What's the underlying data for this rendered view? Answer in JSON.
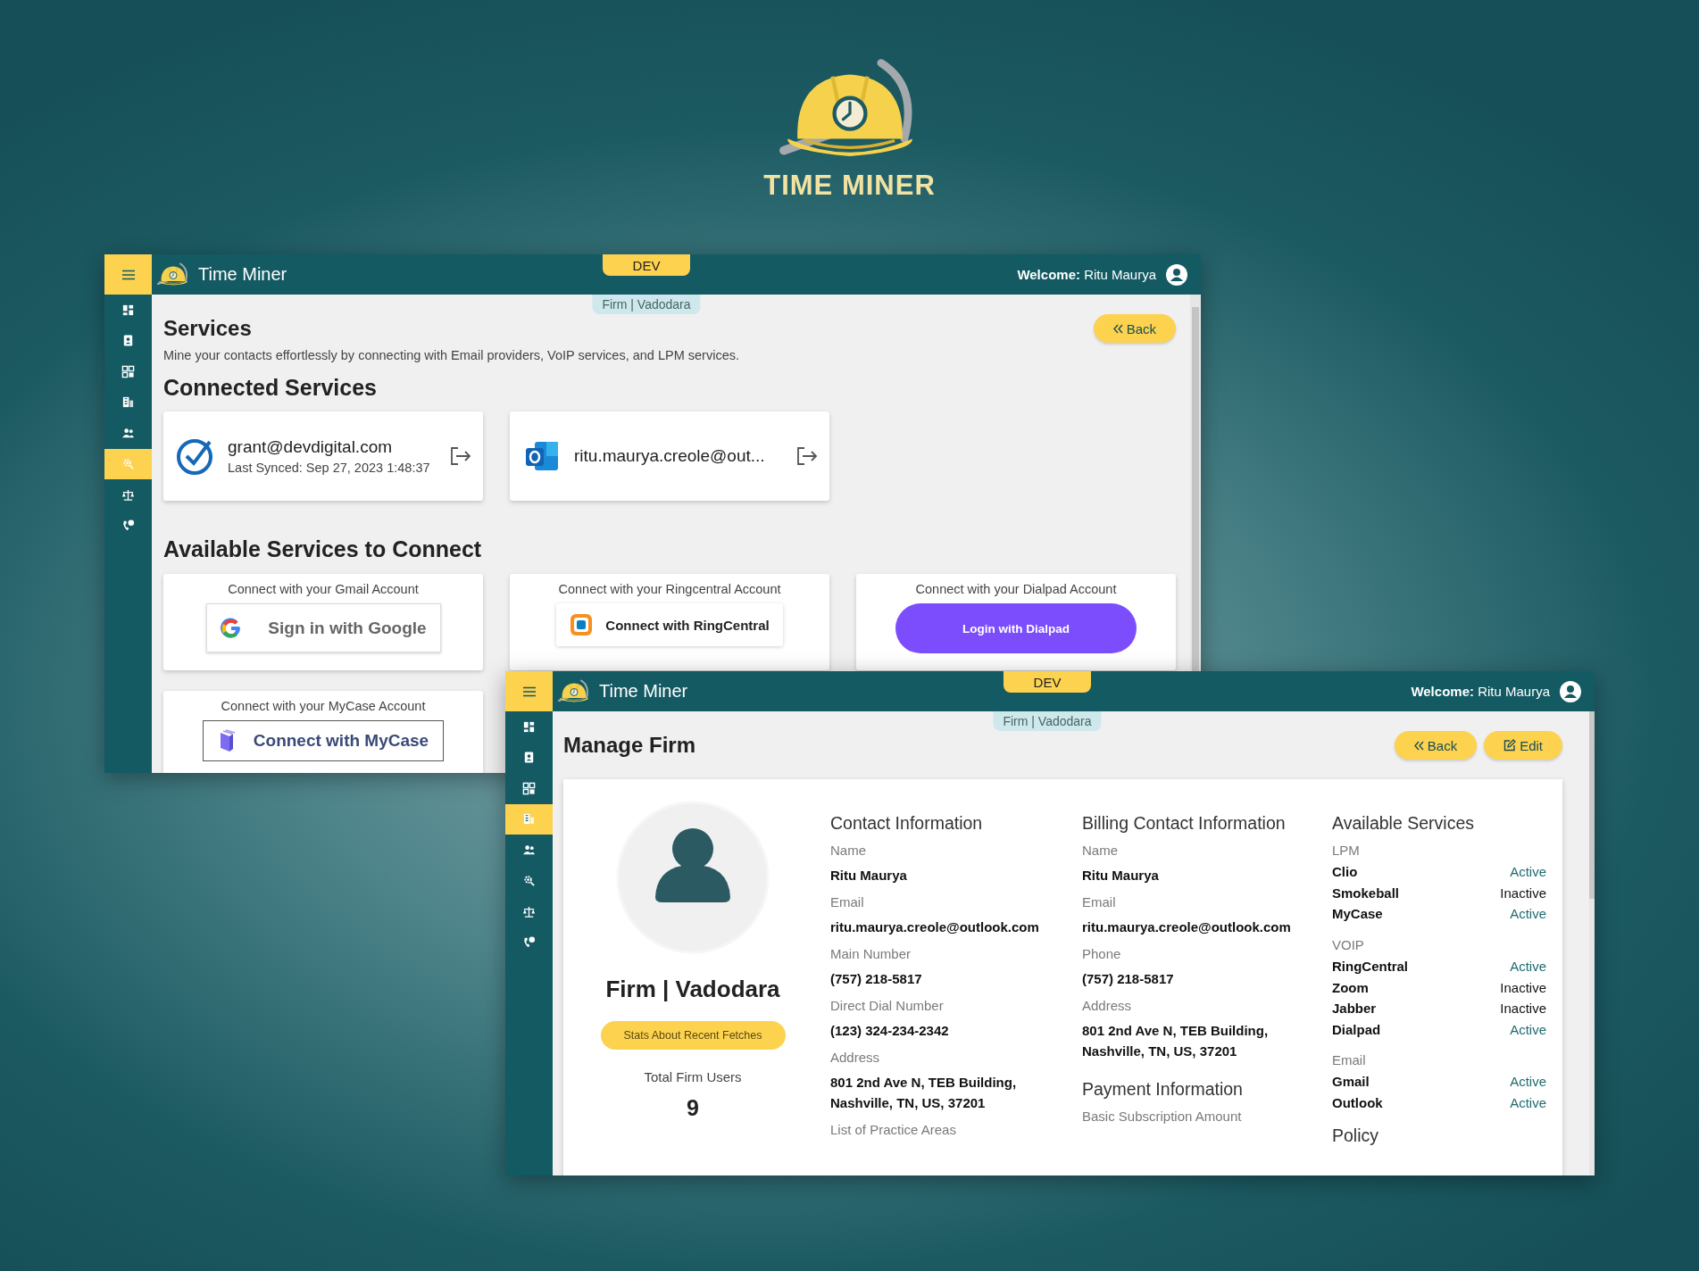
{
  "logo": {
    "text": "TIME MINER"
  },
  "services_window": {
    "header": {
      "app_name": "Time Miner",
      "env_badge": "DEV",
      "welcome_label": "Welcome:",
      "user_name": "Ritu Maurya",
      "context": "Firm | Vadodara"
    },
    "sidebar": [
      {
        "selected": false
      },
      {
        "selected": false
      },
      {
        "selected": false
      },
      {
        "selected": false
      },
      {
        "selected": false
      },
      {
        "selected": true
      },
      {
        "selected": false
      },
      {
        "selected": false
      }
    ],
    "title": "Services",
    "back_button": "Back",
    "description": "Mine your contacts effortlessly by connecting with Email providers, VoIP services, and LPM services.",
    "connected_title": "Connected Services",
    "connected": [
      {
        "kind": "check",
        "email": "grant@devdigital.com",
        "synced": "Last Synced: Sep 27, 2023 1:48:37"
      },
      {
        "kind": "outlook",
        "email": "ritu.maurya.creole@out..."
      }
    ],
    "available_title": "Available Services to Connect",
    "available": [
      {
        "kind": "google",
        "prompt": "Connect with your Gmail Account",
        "button": "Sign in with Google"
      },
      {
        "kind": "ringcentral",
        "prompt": "Connect with your Ringcentral Account",
        "button": "Connect with RingCentral"
      },
      {
        "kind": "dialpad",
        "prompt": "Connect with your Dialpad Account",
        "button": "Login with Dialpad"
      },
      {
        "kind": "mycase",
        "prompt": "Connect with your MyCase Account",
        "button": "Connect with MyCase"
      }
    ]
  },
  "firm_window": {
    "header": {
      "app_name": "Time Miner",
      "env_badge": "DEV",
      "welcome_label": "Welcome:",
      "user_name": "Ritu Maurya",
      "context": "Firm | Vadodara"
    },
    "sidebar": [
      {
        "selected": false
      },
      {
        "selected": false
      },
      {
        "selected": false
      },
      {
        "selected": true
      },
      {
        "selected": false
      },
      {
        "selected": false
      },
      {
        "selected": false
      },
      {
        "selected": false
      }
    ],
    "title": "Manage Firm",
    "back_button": "Back",
    "edit_button": "Edit",
    "profile": {
      "name": "Firm | Vadodara",
      "stats_button": "Stats About Recent Fetches",
      "users_label": "Total Firm Users",
      "users_count": "9"
    },
    "contact": {
      "title": "Contact Information",
      "fields": [
        {
          "label": "Name",
          "value": "Ritu Maurya"
        },
        {
          "label": "Email",
          "value": "ritu.maurya.creole@outlook.com"
        },
        {
          "label": "Main Number",
          "value": "(757) 218-5817"
        },
        {
          "label": "Direct Dial Number",
          "value": "(123) 324-234-2342"
        },
        {
          "label": "Address",
          "value": "801 2nd Ave N, TEB Building, Nashville, TN, US, 37201"
        },
        {
          "label": "List of Practice Areas"
        }
      ]
    },
    "billing": {
      "title": "Billing Contact Information",
      "fields": [
        {
          "label": "Name",
          "value": "Ritu Maurya"
        },
        {
          "label": "Email",
          "value": "ritu.maurya.creole@outlook.com"
        },
        {
          "label": "Phone",
          "value": "(757) 218-5817"
        },
        {
          "label": "Address",
          "value": "801 2nd Ave N, TEB Building, Nashville, TN, US, 37201"
        }
      ]
    },
    "payment": {
      "title": "Payment Information",
      "fields": [
        {
          "label": "Basic Subscription Amount"
        }
      ]
    },
    "services": {
      "title": "Available Services",
      "groups": [
        {
          "name": "LPM",
          "items": [
            {
              "name": "Clio",
              "status": "Active",
              "active": true
            },
            {
              "name": "Smokeball",
              "status": "Inactive",
              "active": false
            },
            {
              "name": "MyCase",
              "status": "Active",
              "active": true
            }
          ]
        },
        {
          "name": "VOIP",
          "items": [
            {
              "name": "RingCentral",
              "status": "Active",
              "active": true
            },
            {
              "name": "Zoom",
              "status": "Inactive",
              "active": false
            },
            {
              "name": "Jabber",
              "status": "Inactive",
              "active": false
            },
            {
              "name": "Dialpad",
              "status": "Active",
              "active": true
            }
          ]
        },
        {
          "name": "Email",
          "items": [
            {
              "name": "Gmail",
              "status": "Active",
              "active": true
            },
            {
              "name": "Outlook",
              "status": "Active",
              "active": true
            }
          ]
        }
      ],
      "policy_title": "Policy"
    }
  }
}
